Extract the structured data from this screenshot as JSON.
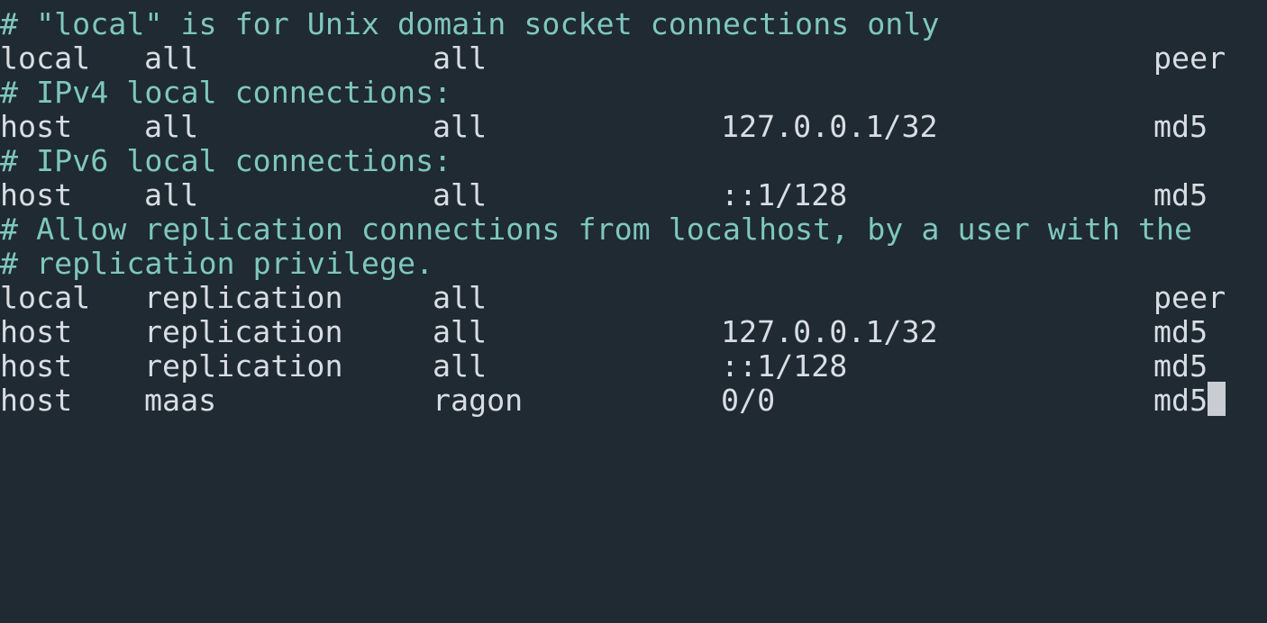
{
  "terminal": {
    "lines": [
      {
        "kind": "comment",
        "text": "# \"local\" is for Unix domain socket connections only"
      },
      {
        "kind": "entry",
        "type": "local",
        "database": "all",
        "user": "all",
        "address": "",
        "method": "peer"
      },
      {
        "kind": "comment",
        "text": "# IPv4 local connections:"
      },
      {
        "kind": "entry",
        "type": "host",
        "database": "all",
        "user": "all",
        "address": "127.0.0.1/32",
        "method": "md5"
      },
      {
        "kind": "comment",
        "text": "# IPv6 local connections:"
      },
      {
        "kind": "entry",
        "type": "host",
        "database": "all",
        "user": "all",
        "address": "::1/128",
        "method": "md5"
      },
      {
        "kind": "comment",
        "text": "# Allow replication connections from localhost, by a user with the"
      },
      {
        "kind": "comment",
        "text": "# replication privilege."
      },
      {
        "kind": "entry",
        "type": "local",
        "database": "replication",
        "user": "all",
        "address": "",
        "method": "peer"
      },
      {
        "kind": "entry",
        "type": "host",
        "database": "replication",
        "user": "all",
        "address": "127.0.0.1/32",
        "method": "md5"
      },
      {
        "kind": "entry",
        "type": "host",
        "database": "replication",
        "user": "all",
        "address": "::1/128",
        "method": "md5"
      },
      {
        "kind": "entry",
        "type": "host",
        "database": "maas",
        "user": "ragon",
        "address": "0/0",
        "method": "md5"
      }
    ],
    "colors": {
      "background": "#1f2a33",
      "text": "#d9dde3",
      "comment": "#7fc7bd",
      "cursor": "#c9cdd2"
    }
  }
}
